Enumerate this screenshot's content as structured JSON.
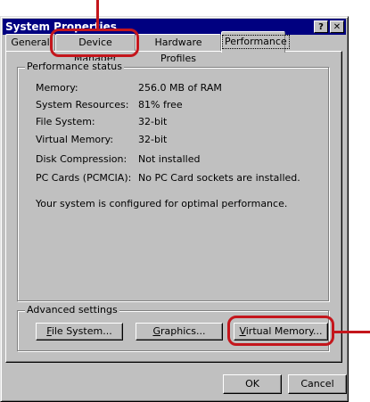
{
  "window": {
    "title": "System Properties",
    "help_btn": "?",
    "close_btn": "✕"
  },
  "tabs": [
    {
      "label": "General"
    },
    {
      "label": "Device Manager"
    },
    {
      "label": "Hardware Profiles"
    },
    {
      "label": "Performance"
    }
  ],
  "status": {
    "legend": "Performance status",
    "rows": [
      {
        "label": "Memory:",
        "value": "256.0 MB of RAM"
      },
      {
        "label": "System Resources:",
        "value": "81% free"
      },
      {
        "label": "File System:",
        "value": "32-bit"
      },
      {
        "label": "Virtual Memory:",
        "value": "32-bit"
      },
      {
        "label": "Disk Compression:",
        "value": "Not installed"
      },
      {
        "label": "PC Cards (PCMCIA):",
        "value": "No PC Card sockets are installed."
      }
    ],
    "message": "Your system is configured for optimal performance."
  },
  "advanced": {
    "legend": "Advanced settings",
    "file_system_mnemonic": "F",
    "file_system_rest": "ile System...",
    "graphics_mnemonic": "G",
    "graphics_rest": "raphics...",
    "virtual_memory_mnemonic": "V",
    "virtual_memory_rest": "irtual Memory..."
  },
  "footer": {
    "ok": "OK",
    "cancel": "Cancel"
  },
  "colors": {
    "title_bar": "#000080",
    "face": "#c0c0c0",
    "highlight": "#c4161c"
  }
}
